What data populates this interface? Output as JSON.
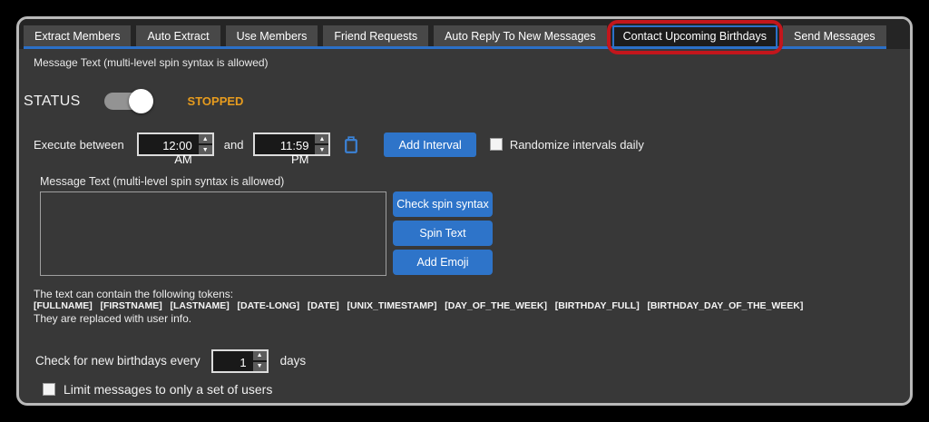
{
  "tabs": [
    {
      "label": "Extract Members",
      "selected": false
    },
    {
      "label": "Auto Extract",
      "selected": false
    },
    {
      "label": "Use Members",
      "selected": false
    },
    {
      "label": "Friend Requests",
      "selected": false
    },
    {
      "label": "Auto Reply To New Messages",
      "selected": false
    },
    {
      "label": "Contact Upcoming Birthdays",
      "selected": true
    },
    {
      "label": "Send Messages",
      "selected": false
    }
  ],
  "status": {
    "label": "STATUS",
    "value": "STOPPED",
    "toggle_state": "off"
  },
  "interval": {
    "label": "Execute between",
    "start_time": "12:00 AM",
    "conjunction": "and",
    "end_time": "11:59 PM",
    "add_button": "Add Interval",
    "randomize_label": "Randomize intervals daily",
    "randomize_checked": false
  },
  "message": {
    "label": "Message Text  (multi-level spin syntax is allowed)",
    "text": "",
    "buttons": {
      "check": "Check spin syntax",
      "spin": "Spin Text",
      "emoji": "Add Emoji"
    }
  },
  "tokens": {
    "intro": "The text can contain the following tokens:",
    "list": "[FULLNAME]   [FIRSTNAME]   [LASTNAME]   [DATE-LONG]   [DATE]   [UNIX_TIMESTAMP]   [DAY_OF_THE_WEEK]   [BIRTHDAY_FULL]   [BIRTHDAY_DAY_OF_THE_WEEK]",
    "outro": "They are replaced with user info."
  },
  "birthday_check": {
    "label_before": "Check for new birthdays every",
    "value": "1",
    "label_after": "days"
  },
  "limit": {
    "label": "Limit messages to only a set of users",
    "checked": false
  },
  "icons": {
    "up": "▲",
    "down": "▼"
  },
  "colors": {
    "accent_blue": "#2e74c9",
    "tab_underline_blue": "#2b70c8",
    "status_orange": "#e79c1e",
    "annotation_red": "#c3161c",
    "panel_bg": "#383838"
  }
}
